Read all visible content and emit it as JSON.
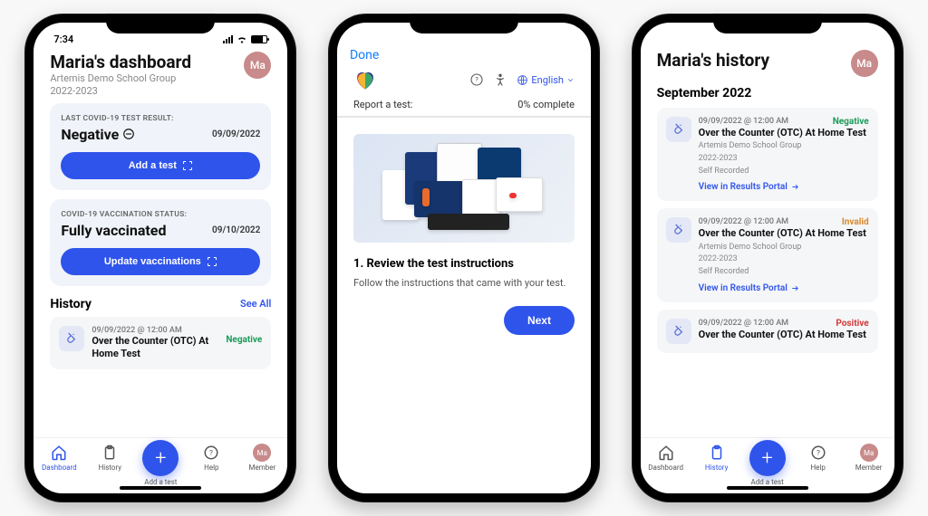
{
  "phone1": {
    "status_time": "7:34",
    "title": "Maria's dashboard",
    "subtitle1": "Artemis Demo School Group",
    "subtitle2": "2022-2023",
    "avatar_initials": "Ma",
    "test_card": {
      "label": "LAST COVID-19 TEST RESULT:",
      "value": "Negative",
      "date": "09/09/2022",
      "button": "Add a test"
    },
    "vax_card": {
      "label": "COVID-19 VACCINATION STATUS:",
      "value": "Fully vaccinated",
      "date": "09/10/2022",
      "button": "Update vaccinations"
    },
    "history_heading": "History",
    "see_all": "See All",
    "history_item": {
      "date": "09/09/2022 @ 12:00 AM",
      "title": "Over the Counter (OTC) At Home Test",
      "status": "Negative"
    },
    "tabs": {
      "dashboard": "Dashboard",
      "history": "History",
      "add": "Add a test",
      "help": "Help",
      "member": "Member",
      "member_initials": "Ma"
    }
  },
  "phone2": {
    "done": "Done",
    "help_aria": "help",
    "accessibility_aria": "accessibility",
    "lang_label": "English",
    "progress_label": "Report a test:",
    "progress_value": "0% complete",
    "step_title": "1. Review the test instructions",
    "step_desc": "Follow the instructions that came with your test.",
    "next": "Next"
  },
  "phone3": {
    "title": "Maria's history",
    "avatar_initials": "Ma",
    "month": "September 2022",
    "items": [
      {
        "date": "09/09/2022 @ 12:00 AM",
        "title": "Over the Counter (OTC) At Home Test",
        "sub1": "Artemis Demo School Group",
        "sub2": "2022-2023",
        "sub3": "Self Recorded",
        "link": "View in Results Portal",
        "status": "Negative",
        "status_class": "neg"
      },
      {
        "date": "09/09/2022 @ 12:00 AM",
        "title": "Over the Counter (OTC) At Home Test",
        "sub1": "Artemis Demo School Group",
        "sub2": "2022-2023",
        "sub3": "Self Recorded",
        "link": "View in Results Portal",
        "status": "Invalid",
        "status_class": "inv"
      },
      {
        "date": "09/09/2022 @ 12:00 AM",
        "title": "Over the Counter (OTC) At Home Test",
        "sub1": "",
        "sub2": "",
        "sub3": "",
        "link": "",
        "status": "Positive",
        "status_class": "pos"
      }
    ],
    "tabs": {
      "dashboard": "Dashboard",
      "history": "History",
      "add": "Add a test",
      "help": "Help",
      "member": "Member",
      "member_initials": "Ma"
    }
  }
}
